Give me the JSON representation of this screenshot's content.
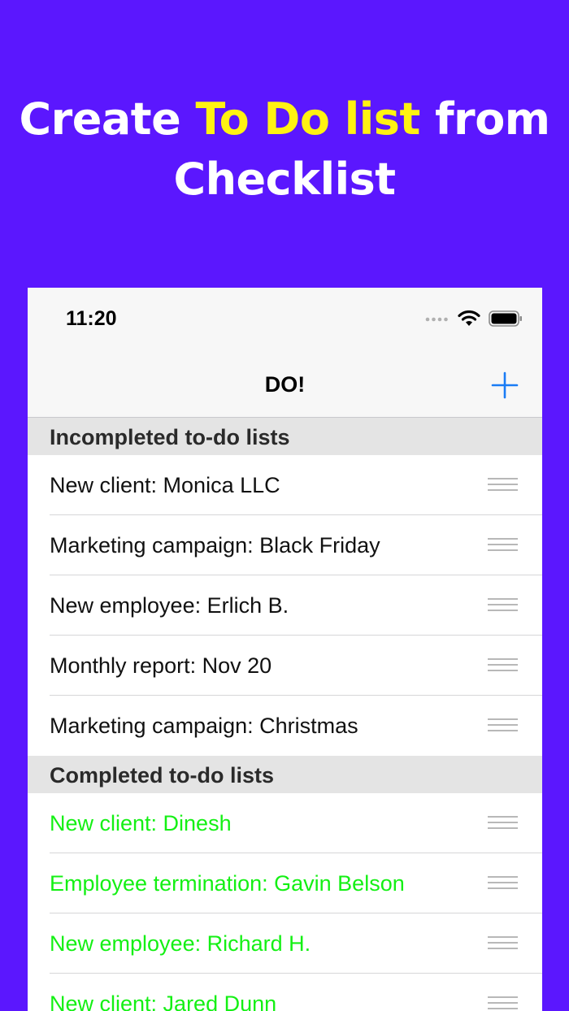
{
  "promo": {
    "line1_pre": "Create ",
    "line1_highlight": "To Do list",
    "line1_post": " from",
    "line2": "Checklist"
  },
  "status": {
    "time": "11:20",
    "icons": [
      "cellular-signal-icon",
      "wifi-icon",
      "battery-icon"
    ]
  },
  "nav": {
    "title": "DO!",
    "add_icon": "plus-icon"
  },
  "sections": {
    "incompleted": {
      "header": "Incompleted to-do lists",
      "items": [
        "New client: Monica LLC",
        "Marketing campaign: Black Friday",
        "New employee: Erlich B.",
        "Monthly report: Nov 20",
        "Marketing campaign: Christmas"
      ]
    },
    "completed": {
      "header": "Completed to-do lists",
      "items": [
        "New client: Dinesh",
        "Employee termination: Gavin Belson",
        "New employee: Richard H.",
        "New client: Jared Dunn"
      ]
    }
  },
  "colors": {
    "background": "#5b17fe",
    "highlight": "#fff212",
    "completed_text": "#14f014",
    "accent": "#1a7cf5"
  }
}
